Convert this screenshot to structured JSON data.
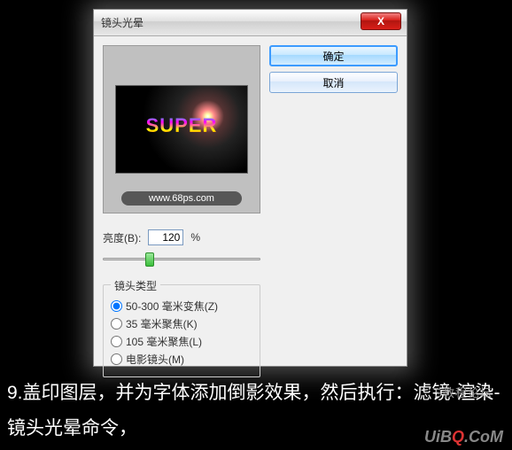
{
  "bg_text": "SUPER",
  "dialog": {
    "title": "镜头光晕",
    "close": "X",
    "preview_text": "SUPER",
    "watermark": "www.68ps.com",
    "brightness_label": "亮度(B):",
    "brightness_value": "120",
    "brightness_unit": "%",
    "lens_legend": "镜头类型",
    "lens_options": [
      "50-300 毫米变焦(Z)",
      "35 毫米聚焦(K)",
      "105 毫米聚焦(L)",
      "电影镜头(M)"
    ],
    "ok": "确定",
    "cancel": "取消"
  },
  "instruction": "9.盖印图层，并为字体添加倒影效果，然后执行：滤镜-渲染-镜头光晕命令，",
  "wm1": "S教程论坛",
  "wm2_a": "UiB",
  "wm2_b": "Q",
  "wm2_c": ".CoM"
}
